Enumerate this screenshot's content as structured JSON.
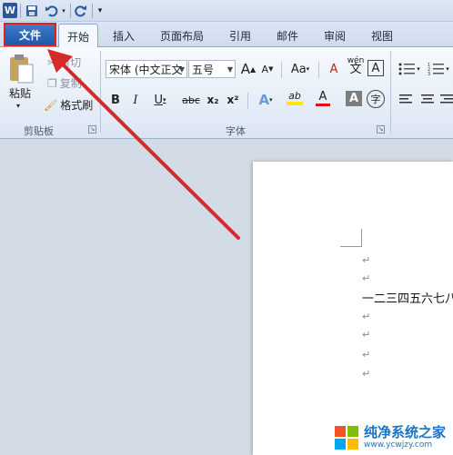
{
  "qat": {
    "app_icon_letter": "W",
    "save_tip": "save",
    "undo_tip": "undo",
    "redo_tip": "redo"
  },
  "tabs": [
    {
      "id": "file",
      "label": "文件"
    },
    {
      "id": "home",
      "label": "开始"
    },
    {
      "id": "insert",
      "label": "插入"
    },
    {
      "id": "layout",
      "label": "页面布局"
    },
    {
      "id": "references",
      "label": "引用"
    },
    {
      "id": "mailings",
      "label": "邮件"
    },
    {
      "id": "review",
      "label": "审阅"
    },
    {
      "id": "view",
      "label": "视图"
    }
  ],
  "clipboard": {
    "paste_label": "粘贴",
    "cut_label": "剪切",
    "copy_label": "复制",
    "format_painter_label": "格式刷",
    "group_label": "剪贴板"
  },
  "font": {
    "font_name": "宋体 (中文正文",
    "font_size": "五号",
    "grow_label": "A",
    "shrink_label": "A",
    "case_label": "Aa",
    "clear_label": "A",
    "phonetic_label": "wén",
    "border_label": "A",
    "bold_label": "B",
    "italic_label": "I",
    "underline_label": "U",
    "strike_label": "abc",
    "subscript_label": "x₂",
    "superscript_label": "x²",
    "effects_label": "A",
    "highlight_label": "ab",
    "color_label": "A",
    "shading_label": "A",
    "enclose_label": "字",
    "group_label": "字体"
  },
  "document": {
    "para_mark": "↵",
    "text_line": "一二三四五六七八"
  },
  "watermark": {
    "title": "纯净系统之家",
    "url": "www.ycwjzy.com"
  },
  "colors": {
    "file_tab": "#2a64b4",
    "highlight_box": "#e02020",
    "arrow": "#d42a2a",
    "highlight_yellow": "#ffe600",
    "font_red": "#e01010"
  }
}
